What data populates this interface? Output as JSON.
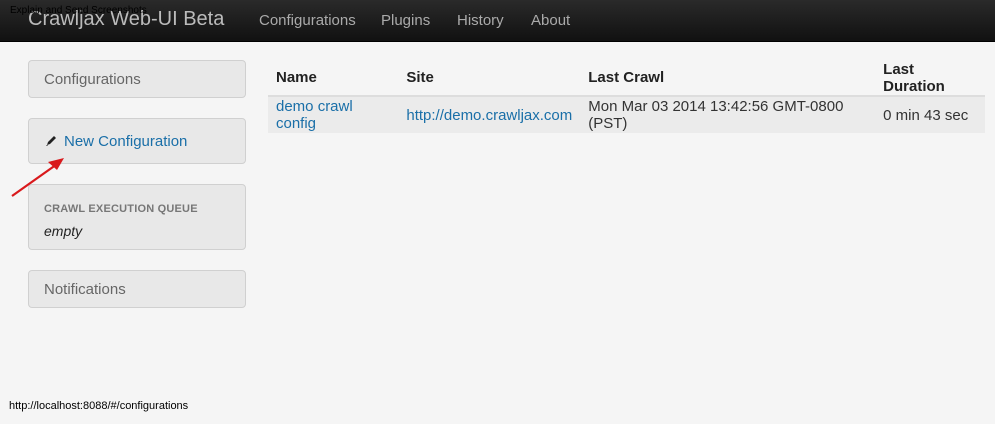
{
  "overlay_title": "Explain and Send Screenshots",
  "navbar": {
    "brand": "Crawljax Web-UI Beta",
    "links": [
      "Configurations",
      "Plugins",
      "History",
      "About"
    ]
  },
  "sidebar": {
    "configurations_label": "Configurations",
    "new_config_label": "New Configuration",
    "queue_heading": "CRAWL EXECUTION QUEUE",
    "queue_value": "empty",
    "notifications_label": "Notifications"
  },
  "table": {
    "headers": [
      "Name",
      "Site",
      "Last Crawl",
      "Last Duration"
    ],
    "rows": [
      [
        "demo crawl config",
        "http://demo.crawljax.com",
        "Mon Mar 03 2014 13:42:56 GMT-0800 (PST)",
        "0 min 43 sec"
      ]
    ]
  },
  "status_url": "http://localhost:8088/#/configurations",
  "colors": {
    "link": "#1a6fa8",
    "annotation_arrow": "#d9191c"
  },
  "icons": {
    "pencil": "pencil-icon",
    "arrow": "annotation-arrow-icon"
  }
}
